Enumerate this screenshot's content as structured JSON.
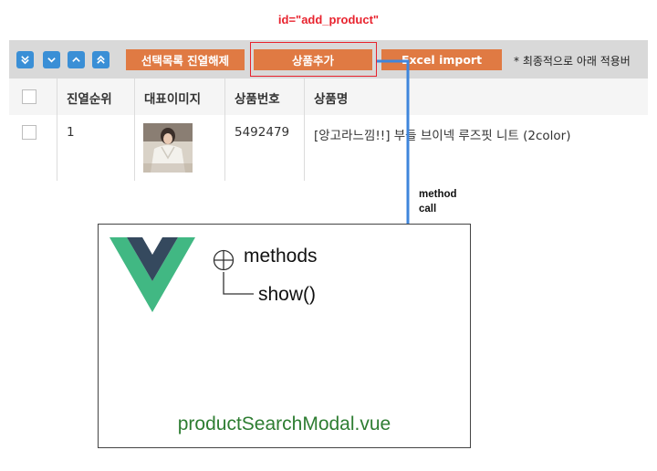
{
  "annotation": {
    "id_label": "id=\"add_product\""
  },
  "toolbar": {
    "nav_icons": [
      "double-chevron-down-icon",
      "chevron-down-icon",
      "chevron-up-icon",
      "double-chevron-up-icon"
    ],
    "buttons": [
      "선택목록 진열해제",
      "상품추가",
      "Excel import"
    ],
    "note": "* 최종적으로 아래 적용버"
  },
  "table": {
    "headers": [
      "",
      "진열순위",
      "대표이미지",
      "상품번호",
      "상품명"
    ],
    "rows": [
      {
        "rank": "1",
        "image": "product-thumbnail",
        "number": "5492479",
        "name": "[앙고라느낌!!] 부들 브이넥 루즈핏 니트 (2color)"
      }
    ]
  },
  "arrow": {
    "label_line1": "method",
    "label_line2": "call"
  },
  "modal": {
    "logo": "vue-logo",
    "methods_label": "methods",
    "method_name": "show()",
    "filename": "productSearchModal.vue"
  },
  "colors": {
    "highlight": "#e8232e",
    "orange_button": "#e07a43",
    "nav_button": "#3a8fd6",
    "arrow": "#3f86dc",
    "vue_green": "#41b883",
    "vue_dark": "#35495e",
    "filename": "#2e7d32"
  }
}
